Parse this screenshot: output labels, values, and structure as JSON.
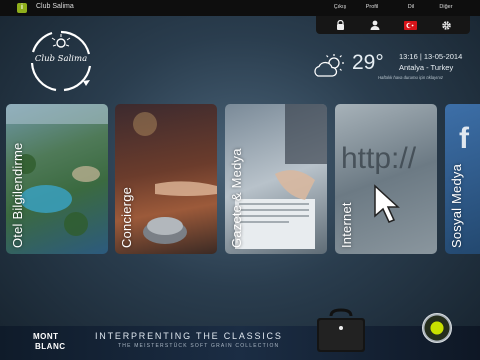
{
  "app": {
    "title": "Club Salima",
    "icon_letter": "i"
  },
  "menu": {
    "labels": [
      "Çıkış",
      "Profil",
      "Dil",
      "Diğer"
    ],
    "icons": [
      "lock-icon",
      "user-icon",
      "turkey-flag-icon",
      "gear-icon"
    ]
  },
  "logo": {
    "text": "Club Salima"
  },
  "weather": {
    "temperature": "29°",
    "datetime": "13:16 | 13-05-2014",
    "location": "Antalya - Turkey",
    "note": "Haftalık hava durumu için tıklayınız",
    "icon": "partly-sunny-icon"
  },
  "tiles": [
    {
      "label": "Otel Bilgilendirme"
    },
    {
      "label": "Concierge"
    },
    {
      "label": "Gazete & Medya"
    },
    {
      "label": "Internet"
    },
    {
      "label": "Sosyal Medya"
    }
  ],
  "ad": {
    "brand_line1": "MONT",
    "brand_line2": "BLANC",
    "headline": "INTERPRENTING THE CLASSICS",
    "subline": "THE MEISTERSTÜCK SOFT GRAIN COLLECTION"
  },
  "colors": {
    "accent_green": "#c8e000",
    "app_icon": "#8fae1b"
  }
}
